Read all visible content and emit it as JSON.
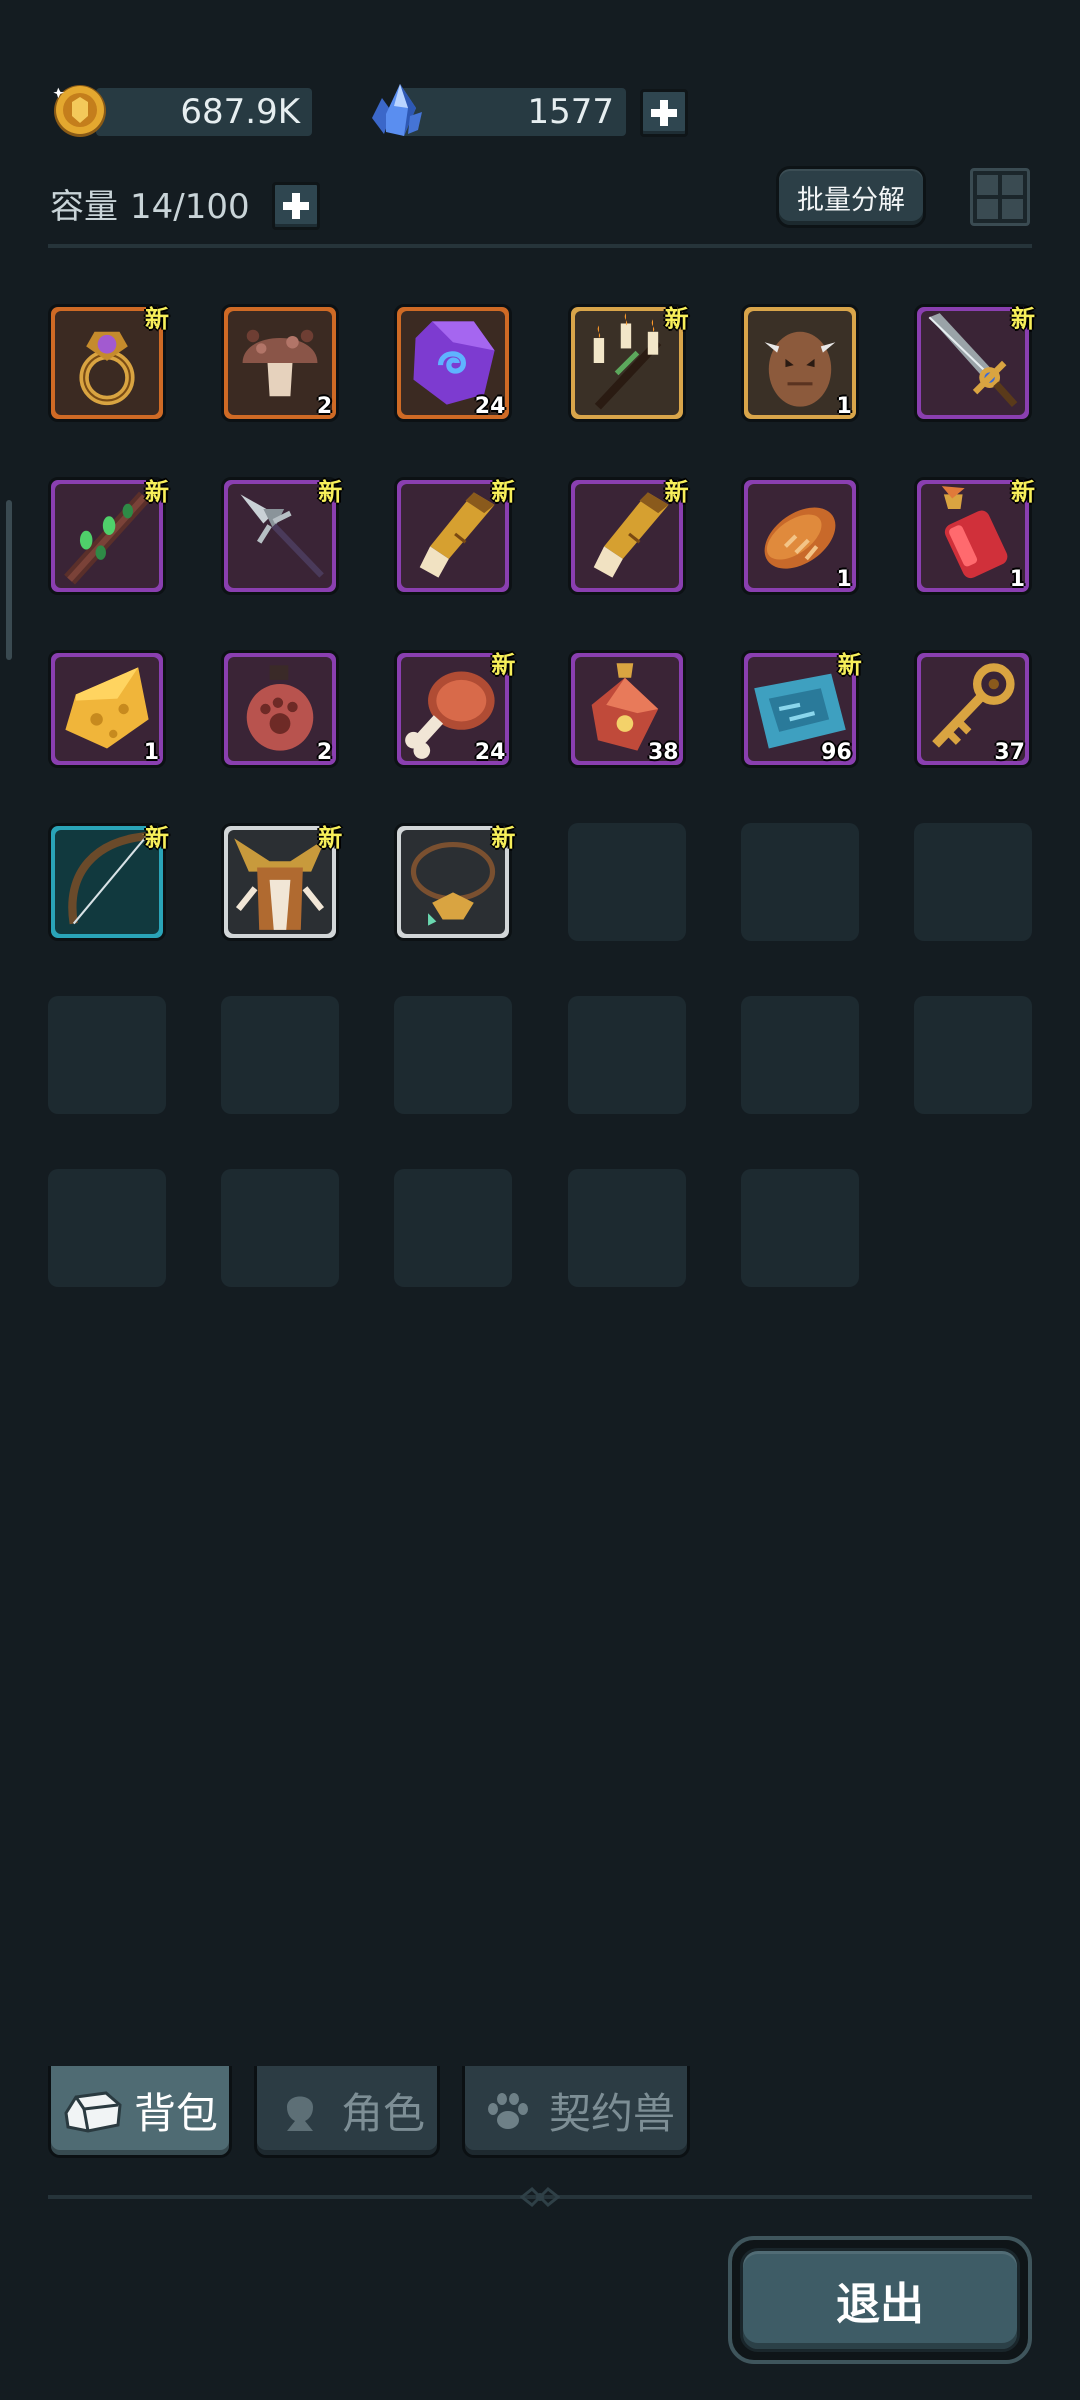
{
  "currency": {
    "gold": "687.9K",
    "gems": "1577"
  },
  "capacity": {
    "label": "容量",
    "value": "14/100"
  },
  "toolbar": {
    "batch_decompose": "批量分解"
  },
  "inventory": {
    "new_label": "新",
    "items": [
      {
        "name": "ring",
        "rarity": "orange",
        "new": true,
        "count": ""
      },
      {
        "name": "mushroom",
        "rarity": "orange",
        "new": false,
        "count": "2"
      },
      {
        "name": "purple-rune-stone",
        "rarity": "orange",
        "new": false,
        "count": "24"
      },
      {
        "name": "candle-staff",
        "rarity": "gold",
        "new": true,
        "count": ""
      },
      {
        "name": "monster-egg",
        "rarity": "gold",
        "new": false,
        "count": "1"
      },
      {
        "name": "great-sword",
        "rarity": "purple",
        "new": true,
        "count": ""
      },
      {
        "name": "thorn-staff",
        "rarity": "purple",
        "new": true,
        "count": ""
      },
      {
        "name": "spear",
        "rarity": "purple",
        "new": true,
        "count": ""
      },
      {
        "name": "golden-gauntlet-1",
        "rarity": "purple",
        "new": true,
        "count": ""
      },
      {
        "name": "golden-gauntlet-2",
        "rarity": "purple",
        "new": true,
        "count": ""
      },
      {
        "name": "bread",
        "rarity": "purple",
        "new": false,
        "count": "1"
      },
      {
        "name": "red-potion-flask",
        "rarity": "purple",
        "new": true,
        "count": "1"
      },
      {
        "name": "cheese",
        "rarity": "purple",
        "new": false,
        "count": "1"
      },
      {
        "name": "paw-potion",
        "rarity": "purple",
        "new": false,
        "count": "2"
      },
      {
        "name": "meat-leg",
        "rarity": "purple",
        "new": true,
        "count": "24"
      },
      {
        "name": "elixir-bottle",
        "rarity": "purple",
        "new": false,
        "count": "38"
      },
      {
        "name": "blue-scroll-map",
        "rarity": "purple",
        "new": true,
        "count": "96"
      },
      {
        "name": "golden-key",
        "rarity": "purple",
        "new": false,
        "count": "37"
      },
      {
        "name": "bow",
        "rarity": "teal",
        "new": true,
        "count": ""
      },
      {
        "name": "horned-helmet",
        "rarity": "white",
        "new": true,
        "count": ""
      },
      {
        "name": "amulet",
        "rarity": "white",
        "new": true,
        "count": ""
      }
    ],
    "empty_slots": 14
  },
  "tabs": [
    {
      "label": "背包",
      "active": true
    },
    {
      "label": "角色",
      "active": false
    },
    {
      "label": "契约兽",
      "active": false
    }
  ],
  "footer": {
    "exit_label": "退出"
  }
}
